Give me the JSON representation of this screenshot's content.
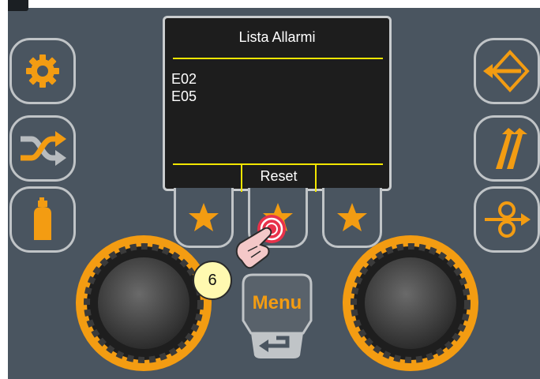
{
  "display": {
    "title": "Lista Allarmi",
    "alarms": [
      "E02",
      "E05"
    ],
    "softkeys": [
      "",
      "Reset",
      ""
    ]
  },
  "buttons": {
    "left": [
      "gear-icon",
      "shuffle-icon",
      "gas-bottle-icon"
    ],
    "right": [
      "diamond-arrow-icon",
      "double-slash-arrows-icon",
      "wire-feed-icon"
    ],
    "favorites": [
      "star-icon",
      "star-icon",
      "star-icon"
    ]
  },
  "menu": {
    "label": "Menu"
  },
  "tutorial": {
    "step": "6"
  },
  "colors": {
    "panel": "#4a5560",
    "accent": "#f39c12",
    "display_bg": "#1d1d1d",
    "display_lines": "#f2e600",
    "border": "#c0c4c7"
  }
}
